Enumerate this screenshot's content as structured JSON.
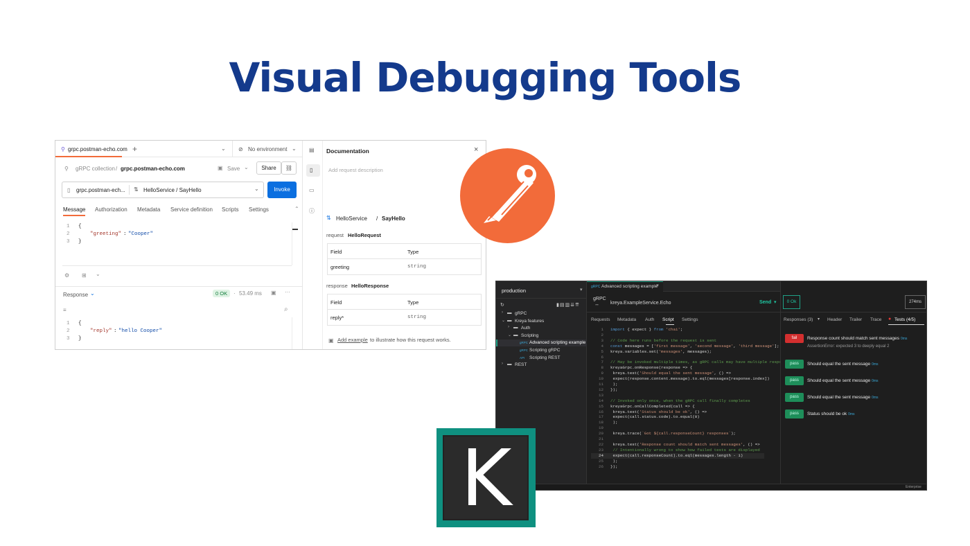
{
  "headline": "Visual Debugging Tools",
  "postman": {
    "tab_title": "grpc.postman-echo.com",
    "environment": "No environment",
    "breadcrumb_collection": "gRPC collection",
    "breadcrumb_sep": "/",
    "breadcrumb_name": "grpc.postman-echo.com",
    "save_label": "Save",
    "share_label": "Share",
    "url": "grpc.postman-ech...",
    "method": "HelloService / SayHello",
    "invoke_label": "Invoke",
    "tabs": [
      "Message",
      "Authorization",
      "Metadata",
      "Service definition",
      "Scripts",
      "Settings"
    ],
    "message_lines": [
      "{",
      "\"greeting\": \"Cooper\"",
      "}"
    ],
    "message_key": "\"greeting\"",
    "message_value": "\"Cooper\"",
    "response_label": "Response",
    "status": "0 OK",
    "time": "53.49 ms",
    "reply_key": "\"reply\"",
    "reply_value": "\"hello Cooper\"",
    "line_numbers": [
      "1",
      "2",
      "3"
    ],
    "doc": {
      "title": "Documentation",
      "placeholder": "Add request description",
      "service": "HelloService",
      "sep": "/",
      "method": "SayHello",
      "request_label": "request",
      "request_type": "HelloRequest",
      "response_label": "response",
      "response_type": "HelloResponse",
      "col_field": "Field",
      "col_type": "Type",
      "request_rows": [
        {
          "field": "greeting",
          "type": "string"
        }
      ],
      "response_rows": [
        {
          "field": "reply*",
          "type": "string"
        }
      ],
      "example_link": "Add example",
      "example_text": "to illustrate how this request works."
    }
  },
  "kreya": {
    "project": "production",
    "tab_title": "Advanced scripting example",
    "tab_tag": "gRPC",
    "protocol": "gRPC",
    "endpoint": "kreya.ExampleService.Echo",
    "send_label": "Send",
    "status": "0 Ok",
    "duration": "274ms",
    "tree": [
      {
        "label": "gRPC",
        "depth": 0,
        "kind": "folder"
      },
      {
        "label": "Kreya features",
        "depth": 0,
        "kind": "folder"
      },
      {
        "label": "Auth",
        "depth": 1,
        "kind": "folder"
      },
      {
        "label": "Scripting",
        "depth": 1,
        "kind": "folder"
      },
      {
        "label": "Advanced scripting example",
        "depth": 2,
        "kind": "grpc",
        "active": true
      },
      {
        "label": "Scripting gRPC",
        "depth": 2,
        "kind": "grpc"
      },
      {
        "label": "Scripting REST",
        "depth": 2,
        "kind": "rest"
      },
      {
        "label": "REST",
        "depth": 0,
        "kind": "folder"
      }
    ],
    "req_tabs": [
      "Requests",
      "Metadata",
      "Auth",
      "Script",
      "Settings"
    ],
    "resp_tabs": [
      "Responses (3)",
      "Header",
      "Trailer",
      "Trace",
      "Tests (4/5)"
    ],
    "code": [
      "import { expect } from 'chai';",
      "",
      "// Code here runs before the request is sent",
      "const messages = ['first message', 'second message', 'third message'];",
      "kreya.variables.set('messages', messages);",
      "",
      "// May be invoked multiple times, as gRPC calls may have multiple responses",
      "kreyaGrpc.onResponse(response => {",
      "  kreya.test('Should equal the sent message', () =>",
      "    expect(response.content.message).to.eql(messages[response.index])",
      "  );",
      "});",
      "",
      "// Invoked only once, when the gRPC call finally completes",
      "kreyaGrpc.onCallCompleted(call => {",
      "  kreya.test('Status should be ok', () =>",
      "    expect(call.status.code).to.equal(0)",
      "  );",
      "",
      "  kreya.trace(`Got ${call.responseCount} responses`);",
      "",
      "  kreya.test('Response count should match sent messages', () =>",
      "    // Intentionally wrong to show how failed tests are displayed",
      "    expect(call.responseCount).to.eql(messages.length - 1)",
      "  );",
      "});"
    ],
    "tests": [
      {
        "status": "fail",
        "name": "Response count should match sent messages",
        "ms": "0ms",
        "detail": "AssertionError: expected 3 to deeply equal 2"
      },
      {
        "status": "pass",
        "name": "Should equal the sent message",
        "ms": "0ms"
      },
      {
        "status": "pass",
        "name": "Should equal the sent message",
        "ms": "0ms"
      },
      {
        "status": "pass",
        "name": "Should equal the sent message",
        "ms": "0ms"
      },
      {
        "status": "pass",
        "name": "Status should be ok",
        "ms": "0ms"
      }
    ],
    "footer": "Enterprise",
    "logo_letter": "K"
  }
}
